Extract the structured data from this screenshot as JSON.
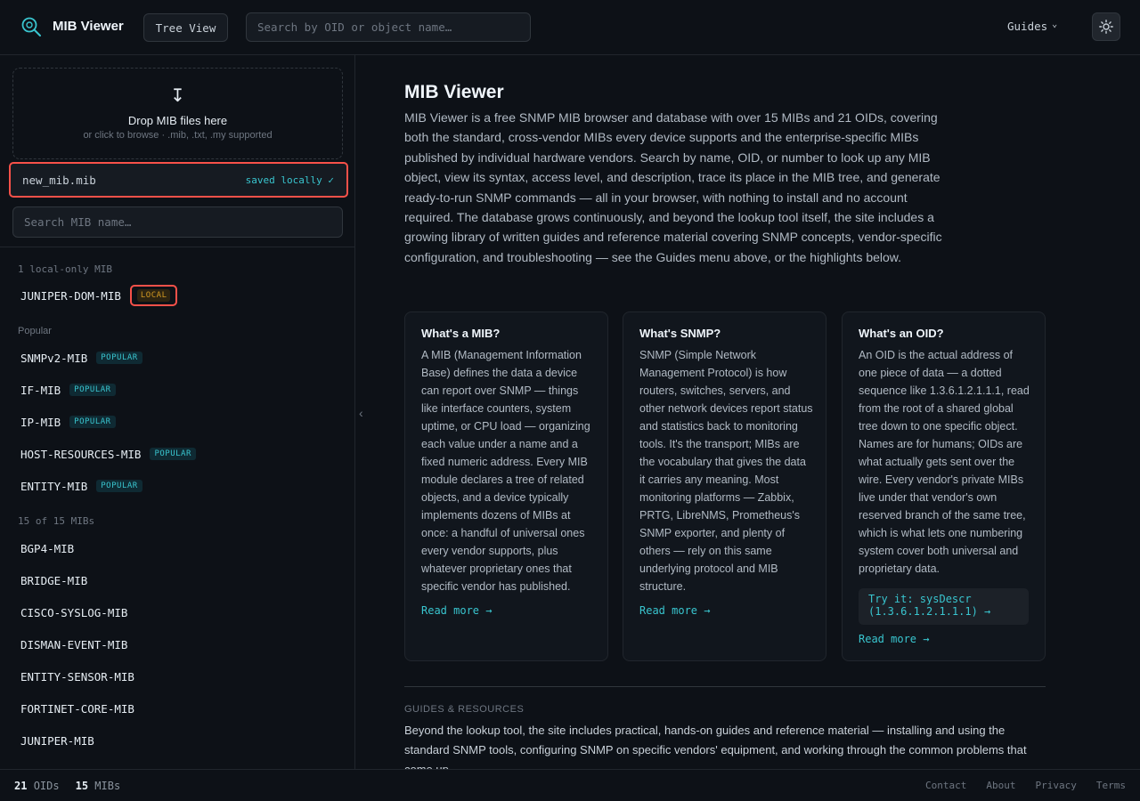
{
  "header": {
    "brand": "MIB Viewer",
    "tree_view": "Tree View",
    "search_placeholder": "Search by OID or object name…",
    "guides": "Guides",
    "chevron": "⌄"
  },
  "sidebar": {
    "drop_title": "Drop MIB files here",
    "drop_sub": "or click to browse · .mib, .txt, .my supported",
    "drop_arrow": "↧",
    "saved_file": "new_mib.mib",
    "saved_status": "saved locally ✓",
    "search_placeholder": "Search MIB name…",
    "local_label": "1 local-only MIB",
    "local_items": [
      {
        "name": "JUNIPER-DOM-MIB",
        "badge": "LOCAL"
      }
    ],
    "popular_label": "Popular",
    "popular_items": [
      {
        "name": "SNMPv2-MIB",
        "badge": "POPULAR"
      },
      {
        "name": "IF-MIB",
        "badge": "POPULAR"
      },
      {
        "name": "IP-MIB",
        "badge": "POPULAR"
      },
      {
        "name": "HOST-RESOURCES-MIB",
        "badge": "POPULAR"
      },
      {
        "name": "ENTITY-MIB",
        "badge": "POPULAR"
      }
    ],
    "all_label": "15 of 15 MIBs",
    "all_items": [
      "BGP4-MIB",
      "BRIDGE-MIB",
      "CISCO-SYSLOG-MIB",
      "DISMAN-EVENT-MIB",
      "ENTITY-SENSOR-MIB",
      "FORTINET-CORE-MIB",
      "JUNIPER-MIB"
    ],
    "collapse": "‹"
  },
  "main": {
    "title": "MIB Viewer",
    "description": "MIB Viewer is a free SNMP MIB browser and database with over 15 MIBs and 21 OIDs, covering both the standard, cross-vendor MIBs every device supports and the enterprise-specific MIBs published by individual hardware vendors. Search by name, OID, or number to look up any MIB object, view its syntax, access level, and description, trace its place in the MIB tree, and generate ready-to-run SNMP commands — all in your browser, with nothing to install and no account required. The database grows continuously, and beyond the lookup tool itself, the site includes a growing library of written guides and reference material covering SNMP concepts, vendor-specific configuration, and troubleshooting — see the Guides menu above, or the highlights below.",
    "cards": [
      {
        "title": "What's a MIB?",
        "text": "A MIB (Management Information Base) defines the data a device can report over SNMP — things like interface counters, system uptime, or CPU load — organizing each value under a name and a fixed numeric address. Every MIB module declares a tree of related objects, and a device typically implements dozens of MIBs at once: a handful of universal ones every vendor supports, plus whatever proprietary ones that specific vendor has published.",
        "link": "Read more →"
      },
      {
        "title": "What's SNMP?",
        "text": "SNMP (Simple Network Management Protocol) is how routers, switches, servers, and other network devices report status and statistics back to monitoring tools. It's the transport; MIBs are the vocabulary that gives the data it carries any meaning. Most monitoring platforms — Zabbix, PRTG, LibreNMS, Prometheus's SNMP exporter, and plenty of others — rely on this same underlying protocol and MIB structure.",
        "link": "Read more →"
      },
      {
        "title": "What's an OID?",
        "text": "An OID is the actual address of one piece of data — a dotted sequence like 1.3.6.1.2.1.1.1, read from the root of a shared global tree down to one specific object. Names are for humans; OIDs are what actually gets sent over the wire. Every vendor's private MIBs live under that vendor's own reserved branch of the same tree, which is what lets one numbering system cover both universal and proprietary data.",
        "tryit": "Try it: sysDescr (1.3.6.1.2.1.1.1) →",
        "link": "Read more →"
      }
    ],
    "guides_label": "GUIDES & RESOURCES",
    "guides_text": "Beyond the lookup tool, the site includes practical, hands-on guides and reference material — installing and using the standard SNMP tools, configuring SNMP on specific vendors' equipment, and working through the common problems that come up."
  },
  "footer": {
    "oid_count": "21",
    "oid_label": "OIDs",
    "mib_count": "15",
    "mib_label": "MIBs",
    "links": [
      "Contact",
      "About",
      "Privacy",
      "Terms"
    ]
  }
}
